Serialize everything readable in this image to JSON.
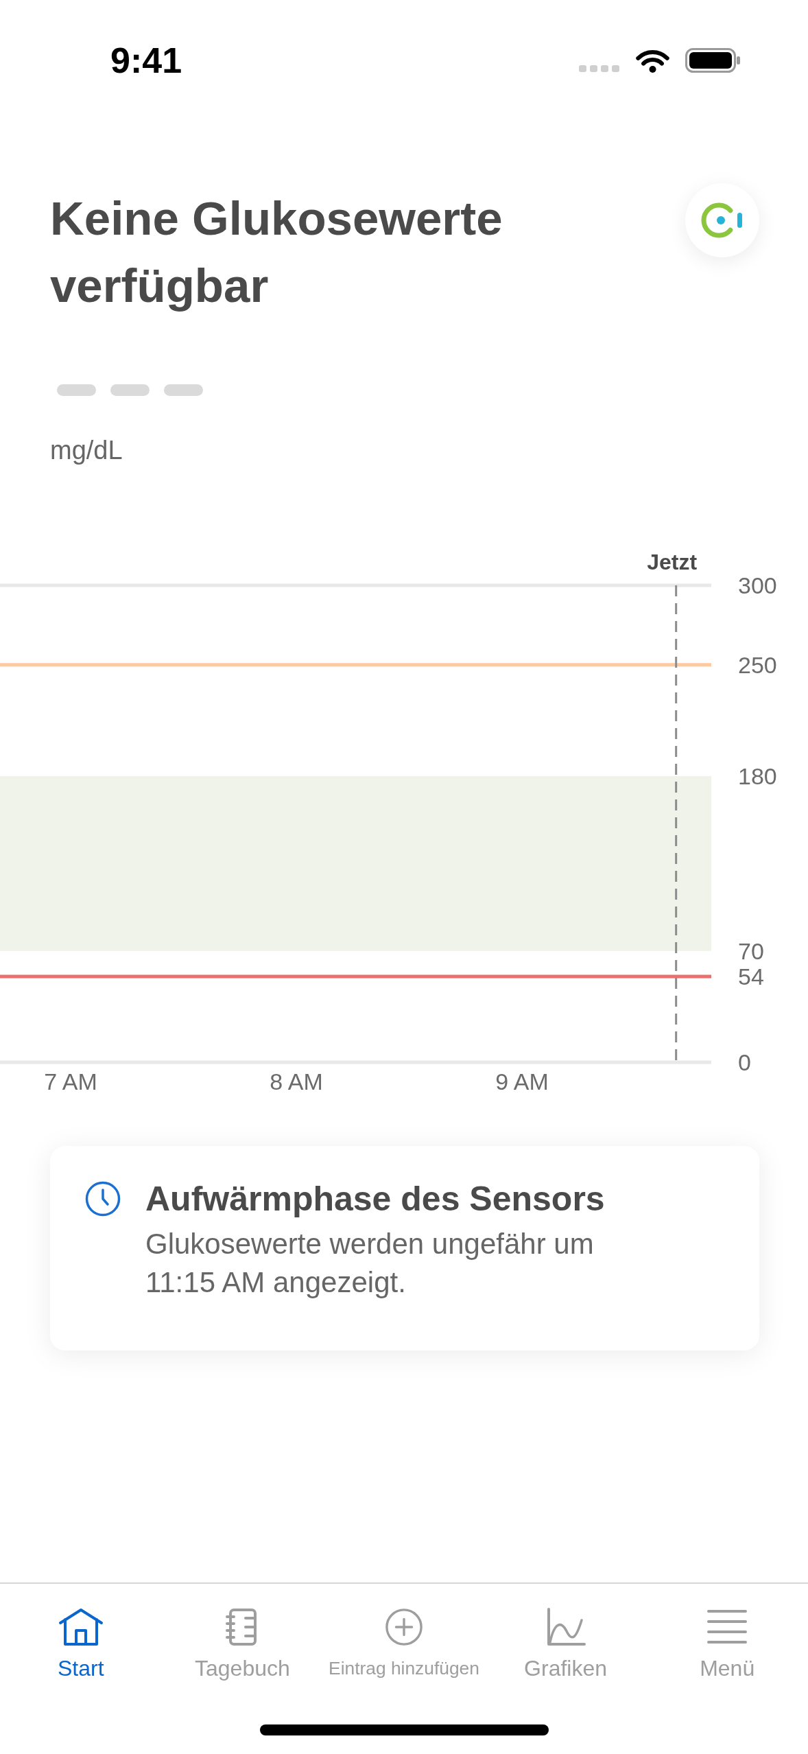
{
  "status_bar": {
    "time": "9:41"
  },
  "header": {
    "title": "Keine Glukosewerte verfügbar",
    "unit": "mg/dL"
  },
  "chart": {
    "chart_data": {
      "type": "line",
      "xlim": [
        6.687,
        9.839
      ],
      "ylim": [
        0,
        300
      ],
      "xticks": [
        {
          "value": 7,
          "label": "7 AM"
        },
        {
          "value": 8,
          "label": "8 AM"
        },
        {
          "value": 9,
          "label": "9 AM"
        }
      ],
      "yticks": [
        0,
        54,
        70,
        180,
        250,
        300
      ],
      "bands": [
        {
          "axis": "y",
          "from": 70,
          "to": 180,
          "color": "#f0f3ea"
        }
      ],
      "ref_lines": [
        {
          "axis": "y",
          "value": 250,
          "color": "#fccaa0"
        },
        {
          "axis": "y",
          "value": 54,
          "color": "#e8706e"
        },
        {
          "axis": "x",
          "value": 9.683,
          "label": "Jetzt"
        }
      ]
    }
  },
  "notice": {
    "title": "Aufwärmphase des Sensors",
    "text": "Glukosewerte werden ungefähr um 11:15 AM angezeigt."
  },
  "tab_bar": {
    "tabs": [
      {
        "label": "Start",
        "selected": true
      },
      {
        "label": "Tagebuch",
        "selected": false
      },
      {
        "label": "Eintrag hinzufügen",
        "selected": false
      },
      {
        "label": "Grafiken",
        "selected": false
      },
      {
        "label": "Menü",
        "selected": false
      }
    ]
  }
}
